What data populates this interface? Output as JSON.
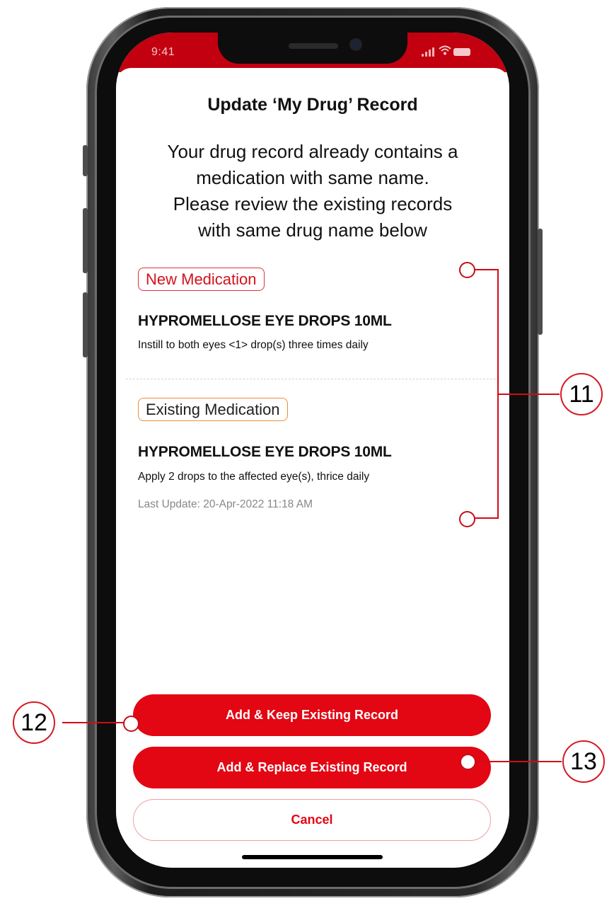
{
  "status_bar": {
    "time": "9:41"
  },
  "dialog": {
    "title": "Update ‘My Drug’ Record",
    "intro_lines": [
      "Your drug record already contains a",
      "medication with same name.",
      "Please review the existing records",
      "with same drug name below"
    ]
  },
  "new_medication": {
    "tag": "New Medication",
    "name": "HYPROMELLOSE EYE DROPS 10ML",
    "instructions": "Instill to both eyes <1> drop(s) three times daily"
  },
  "existing_medication": {
    "tag": "Existing Medication",
    "name": "HYPROMELLOSE EYE DROPS 10ML",
    "instructions": "Apply 2 drops to the affected eye(s), thrice daily",
    "last_update": "Last Update: 20-Apr-2022 11:18 AM"
  },
  "actions": {
    "add_keep": "Add & Keep Existing Record",
    "add_replace": "Add & Replace Existing Record",
    "cancel": "Cancel"
  },
  "annotations": {
    "a11": "11",
    "a12": "12",
    "a13": "13"
  },
  "colors": {
    "brand_red": "#e30613",
    "existing_tag_border": "#ee8d38",
    "annotation_red": "#d10b17"
  }
}
